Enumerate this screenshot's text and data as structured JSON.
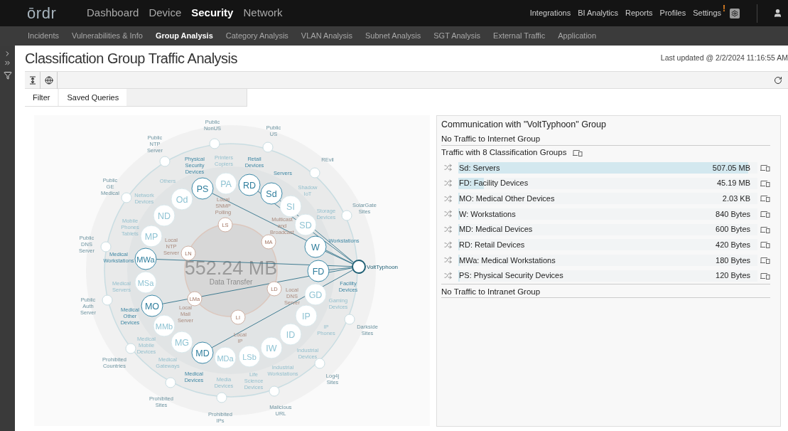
{
  "brand": "ōrdr",
  "main_menu": [
    {
      "label": "Dashboard",
      "selected": false
    },
    {
      "label": "Device",
      "selected": false
    },
    {
      "label": "Security",
      "selected": true
    },
    {
      "label": "Network",
      "selected": false
    }
  ],
  "right_menu": [
    "Integrations",
    "BI Analytics",
    "Reports",
    "Profiles",
    "Settings"
  ],
  "settings_alert": "!",
  "sub_tabs": [
    {
      "label": "Incidents",
      "selected": false
    },
    {
      "label": "Vulnerabilities & Info",
      "selected": false
    },
    {
      "label": "Group Analysis",
      "selected": true
    },
    {
      "label": "Category Analysis",
      "selected": false
    },
    {
      "label": "VLAN Analysis",
      "selected": false
    },
    {
      "label": "Subnet Analysis",
      "selected": false
    },
    {
      "label": "SGT Analysis",
      "selected": false
    },
    {
      "label": "External Traffic",
      "selected": false
    },
    {
      "label": "Application",
      "selected": false
    }
  ],
  "page_title": "Classification Group Traffic Analysis",
  "last_updated": "Last updated @ 2/2/2024 11:16:55 AM",
  "query_tabs": [
    "Filter",
    "Saved Queries"
  ],
  "diagram": {
    "center": {
      "value": "552.24 MB",
      "label": "Data Transfer"
    },
    "external": [
      {
        "label": "Public NonUS",
        "selected": false
      },
      {
        "label": "Public US",
        "selected": false
      },
      {
        "label": "Public NTP Server",
        "selected": false
      },
      {
        "label": "REvil",
        "selected": false
      },
      {
        "label": "Public GE Medical",
        "selected": false
      },
      {
        "label": "SolarGate Sites",
        "selected": false
      },
      {
        "label": "Public DNS Server",
        "selected": false
      },
      {
        "label": "VoltTyphoon",
        "selected": true
      },
      {
        "label": "Public Auth Server",
        "selected": false
      },
      {
        "label": "Darkside Sites",
        "selected": false
      },
      {
        "label": "Prohibited Countries",
        "selected": false
      },
      {
        "label": "Log4j Sites",
        "selected": false
      },
      {
        "label": "Prohibited Sites",
        "selected": false
      },
      {
        "label": "Malicious URL",
        "selected": false
      },
      {
        "label": "Prohibited IPs",
        "selected": false
      }
    ],
    "groups": [
      {
        "abbr": "Od",
        "label": "Others",
        "connected": false
      },
      {
        "abbr": "PS",
        "label": "Physical Security Devices",
        "connected": true
      },
      {
        "abbr": "PA",
        "label": "Printers Copiers",
        "connected": false
      },
      {
        "abbr": "RD",
        "label": "Retail Devices",
        "connected": true
      },
      {
        "abbr": "Sd",
        "label": "Servers",
        "connected": true
      },
      {
        "abbr": "SI",
        "label": "Shadow IoT",
        "connected": false
      },
      {
        "abbr": "ND",
        "label": "Network Devices",
        "connected": false
      },
      {
        "abbr": "SD",
        "label": "Storage Devices",
        "connected": false
      },
      {
        "abbr": "MP",
        "label": "Mobile Phones Tablets",
        "connected": false
      },
      {
        "abbr": "W",
        "label": "Workstations",
        "connected": true
      },
      {
        "abbr": "MWa",
        "label": "Medical Workstations",
        "connected": true
      },
      {
        "abbr": "MSa",
        "label": "Medical Servers",
        "connected": false
      },
      {
        "abbr": "FD",
        "label": "Facility Devices",
        "connected": true
      },
      {
        "abbr": "GD",
        "label": "Gaming Devices",
        "connected": false
      },
      {
        "abbr": "MO",
        "label": "Medical Other Devices",
        "connected": true
      },
      {
        "abbr": "IP",
        "label": "IP Phones",
        "connected": false
      },
      {
        "abbr": "MMb",
        "label": "Medical Mobile Devices",
        "connected": false
      },
      {
        "abbr": "ID",
        "label": "Industrial Devices",
        "connected": false
      },
      {
        "abbr": "MG",
        "label": "Medical Gateways",
        "connected": false
      },
      {
        "abbr": "MD",
        "label": "Medical Devices",
        "connected": true
      },
      {
        "abbr": "MDa",
        "label": "Media Devices",
        "connected": false
      },
      {
        "abbr": "LSb",
        "label": "Life Science Devices",
        "connected": false
      },
      {
        "abbr": "IW",
        "label": "Industrial Workstations",
        "connected": false
      }
    ],
    "local": [
      {
        "abbr": "LS",
        "label": "Local SNMP Polling"
      },
      {
        "abbr": "MA",
        "label": "Multicast and Broadcast"
      },
      {
        "abbr": "LN",
        "label": "Local NTP Server"
      },
      {
        "abbr": "LD",
        "label": "Local DNS Server"
      },
      {
        "abbr": "LMa",
        "label": "Local Mail Server"
      },
      {
        "abbr": "LI",
        "label": "Local IP"
      }
    ]
  },
  "details": {
    "title": "Communication with \"VoltTyphoon\" Group",
    "internet": "No Traffic to Internet Group",
    "groups_heading": "Traffic with 8 Classification Groups",
    "rows": [
      {
        "name": "Sd: Servers",
        "value": "507.05 MB",
        "level": 0.97
      },
      {
        "name": "FD: Facility Devices",
        "value": "45.19 MB",
        "level": 0.085
      },
      {
        "name": "MO: Medical Other Devices",
        "value": "2.03 KB",
        "level": 0
      },
      {
        "name": "W: Workstations",
        "value": "840 Bytes",
        "level": 0
      },
      {
        "name": "MD: Medical Devices",
        "value": "600 Bytes",
        "level": 0
      },
      {
        "name": "RD: Retail Devices",
        "value": "420 Bytes",
        "level": 0
      },
      {
        "name": "MWa: Medical Workstations",
        "value": "180 Bytes",
        "level": 0
      },
      {
        "name": "PS: Physical Security Devices",
        "value": "120 Bytes",
        "level": 0
      }
    ],
    "intranet": "No Traffic to Intranet Group"
  }
}
